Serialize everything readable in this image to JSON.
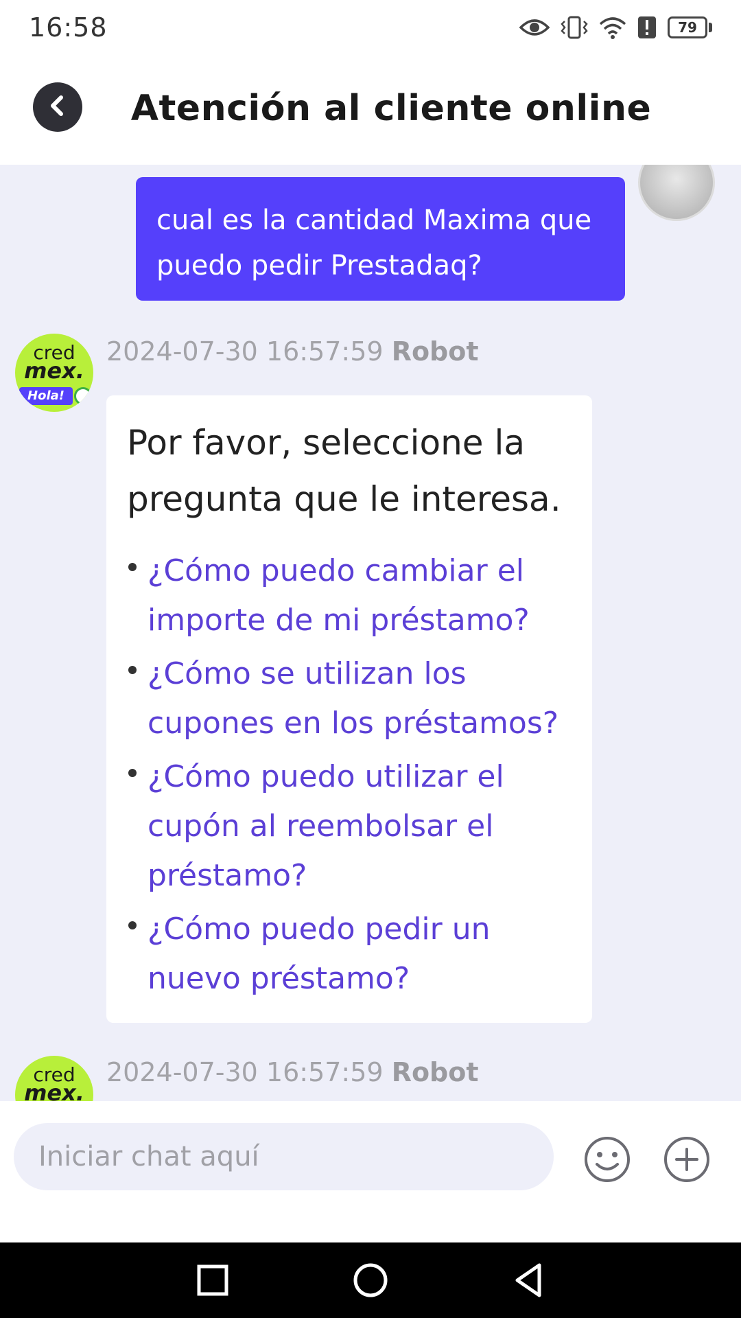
{
  "status_bar": {
    "time": "16:58",
    "battery": "79",
    "icons": [
      "eye-icon",
      "vibrate-icon",
      "wifi-icon",
      "alert-icon",
      "battery-icon"
    ]
  },
  "header": {
    "title": "Atención al cliente online",
    "back_icon": "chevron-left-icon"
  },
  "colors": {
    "accent": "#5540fb",
    "link": "#5b3fd6",
    "chat_bg": "#eeeff9",
    "bot_avatar_bg": "#b8ef3a"
  },
  "messages": {
    "user_message": "cual es la cantidad Maxima que puedo pedir Prestadaq?",
    "bot_avatar": {
      "line1": "cred",
      "line2": "mex.",
      "badge": "Hola!"
    },
    "bot_message_1": {
      "timestamp": "2024-07-30 16:57:59",
      "sender": "Robot",
      "intro": "Por favor, seleccione la pregunta que le interesa.",
      "faqs": [
        "¿Cómo puedo cambiar el importe de mi préstamo?",
        "¿Cómo se utilizan los cupones en los préstamos?",
        "¿Cómo puedo utilizar el cupón al reembolsar el préstamo?",
        "¿Cómo puedo pedir un nuevo préstamo?"
      ]
    },
    "bot_message_2": {
      "timestamp": "2024-07-30 16:57:59",
      "sender": "Robot"
    }
  },
  "input": {
    "placeholder": "Iniciar chat aquí",
    "emoji_icon": "smiley-icon",
    "plus_icon": "plus-circle-icon"
  },
  "nav_bar": {
    "icons": [
      "square-recents-icon",
      "circle-home-icon",
      "triangle-back-icon"
    ]
  }
}
